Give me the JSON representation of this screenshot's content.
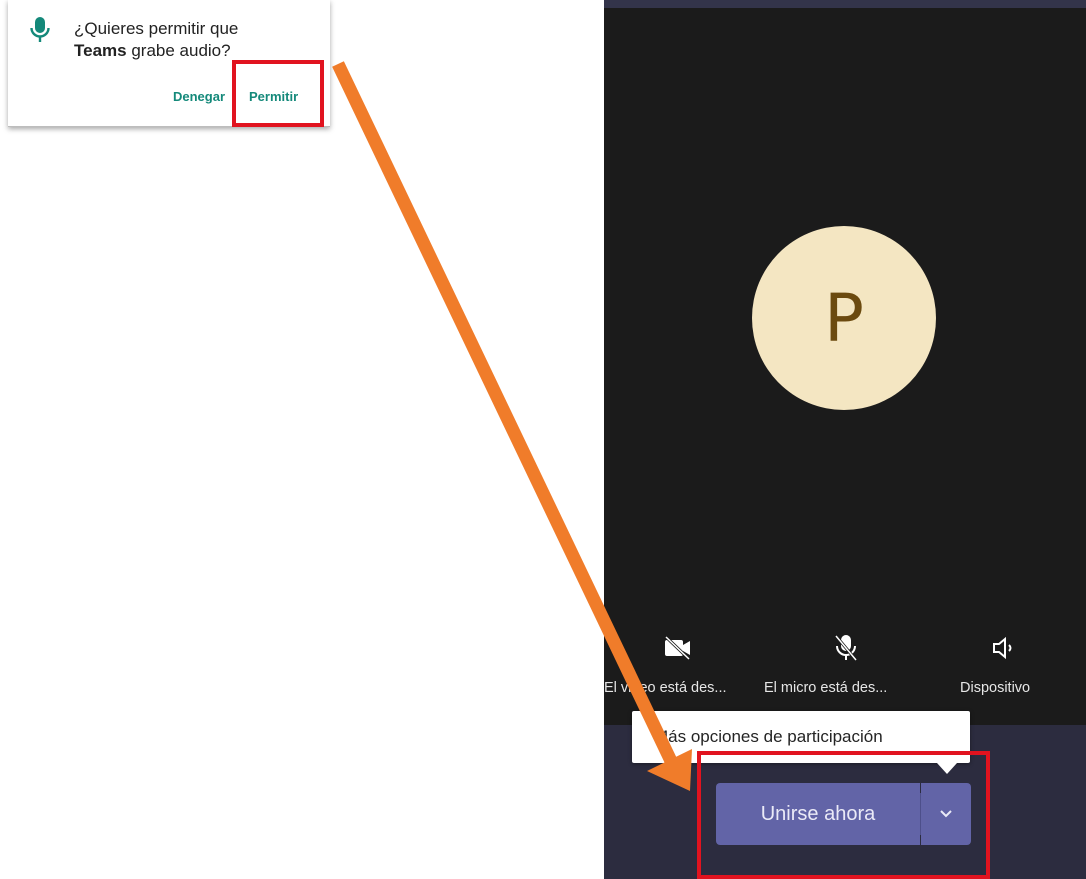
{
  "permission_dialog": {
    "question_prefix": "¿Quieres permitir que",
    "app_name": "Teams",
    "question_suffix": "grabe audio?",
    "deny_label": "Denegar",
    "allow_label": "Permitir",
    "icon": "mic-icon"
  },
  "teams": {
    "avatar_initial": "P",
    "controls": [
      {
        "label": "El video está des...",
        "icon": "video-off-icon"
      },
      {
        "label": "El micro está des...",
        "icon": "mic-off-icon"
      },
      {
        "label": "Dispositivo",
        "icon": "speaker-icon"
      }
    ],
    "tooltip": "Más opciones de participación",
    "join_button": "Unirse ahora",
    "dropdown_icon": "chevron-down-icon"
  },
  "colors": {
    "highlight": "#e1131f",
    "arrow": "#f07c2a",
    "teams_purple": "#6264a7",
    "accent_green": "#14897a"
  }
}
